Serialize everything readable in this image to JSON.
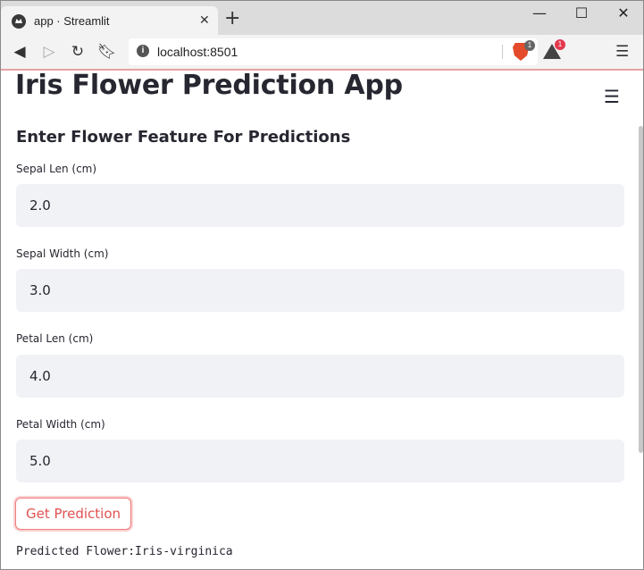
{
  "browser": {
    "tab_title": "app · Streamlit",
    "tab_close": "✕",
    "new_tab": "+",
    "url": "localhost:8501",
    "brave_shield_count": "1",
    "rewards_count": "1",
    "window_controls": {
      "minimize": "—",
      "maximize": "☐",
      "close": "✕"
    }
  },
  "app": {
    "title": "Iris Flower Prediction App",
    "subheader": "Enter Flower Feature For Predictions",
    "fields": [
      {
        "label": "Sepal Len (cm)",
        "value": "2.0"
      },
      {
        "label": "Sepal Width (cm)",
        "value": "3.0"
      },
      {
        "label": "Petal Len (cm)",
        "value": "4.0"
      },
      {
        "label": "Petal Width (cm)",
        "value": "5.0"
      }
    ],
    "button_label": "Get Prediction",
    "result_text": "Predicted Flower:Iris-virginica"
  },
  "colors": {
    "accent": "#f07b7b",
    "input_bg": "#f0f2f6",
    "text": "#262730"
  },
  "icons": [
    "streamlit-favicon",
    "back-icon",
    "forward-icon",
    "reload-icon",
    "bookmark-icon",
    "site-info-icon",
    "brave-shield-icon",
    "brave-rewards-icon",
    "browser-menu-icon",
    "hamburger-menu-icon"
  ]
}
